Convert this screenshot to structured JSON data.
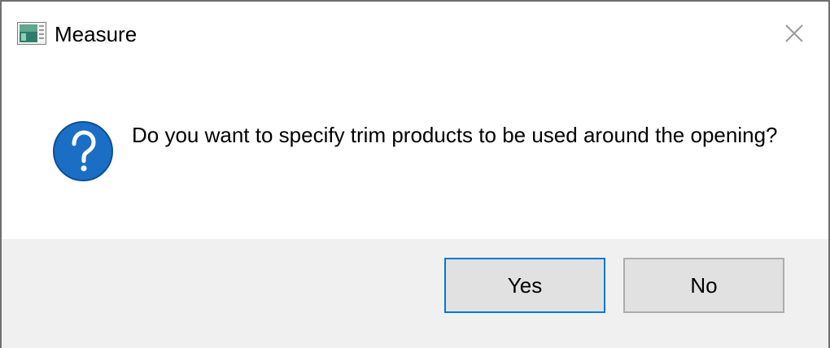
{
  "window": {
    "title": "Measure",
    "app_icon": "measure-app-icon",
    "close_icon": "close-icon"
  },
  "message": {
    "icon": "question-icon",
    "text": "Do you want to specify trim products to be used around the opening?"
  },
  "buttons": {
    "yes_label": "Yes",
    "no_label": "No",
    "default": "Yes"
  },
  "colors": {
    "question_icon": "#1a6fc4",
    "footer_bg": "#f0f0f0",
    "button_bg": "#e1e1e1",
    "default_button_border": "#0078d7",
    "button_border": "#adadad"
  }
}
